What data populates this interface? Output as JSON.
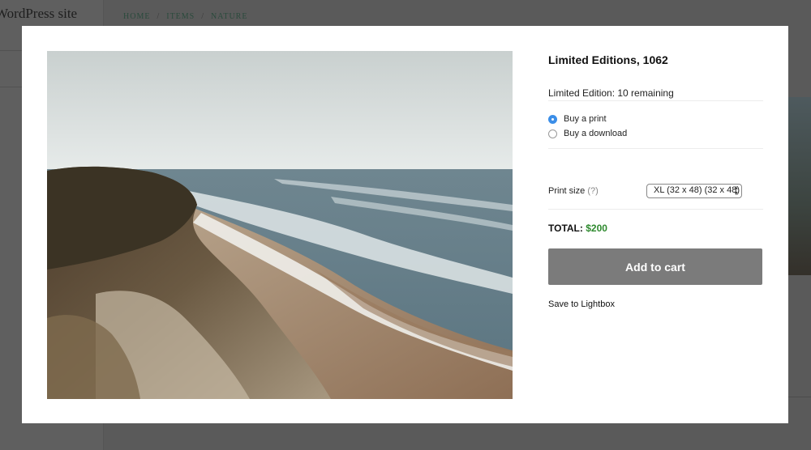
{
  "background": {
    "site_title": "WordPress site",
    "breadcrumb": [
      "HOME",
      "ITEMS",
      "NATURE"
    ]
  },
  "product": {
    "title": "Limited Editions, 1062",
    "remaining": "Limited Edition: 10 remaining",
    "options": [
      {
        "label": "Buy a print",
        "checked": true
      },
      {
        "label": "Buy a download",
        "checked": false
      }
    ],
    "print_size_label": "Print size",
    "print_size_help": "(?)",
    "print_size_value": "XL (32 x 48) (32 x 48)",
    "total_label": "TOTAL:",
    "total_value": "$200",
    "add_to_cart": "Add to cart",
    "save_to_lightbox": "Save to Lightbox"
  },
  "colors": {
    "accent_radio": "#3b8ee8",
    "price": "#2e8a2e",
    "button": "#7b7b7b"
  }
}
